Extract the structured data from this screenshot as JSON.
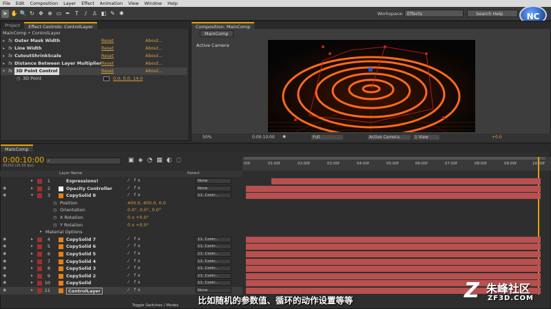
{
  "menu": [
    "File",
    "Edit",
    "Composition",
    "Layer",
    "Effect",
    "Animation",
    "View",
    "Window",
    "Help"
  ],
  "workspace": {
    "label": "Workspace:",
    "value": "Effects",
    "search_placeholder": "Search Help"
  },
  "left_panel": {
    "tabs": [
      "Project",
      "Effect Controls: ControlLayer"
    ],
    "breadcrumb": "MainComp • ControlLayer",
    "effects": [
      {
        "name": "Outer Mask Width",
        "reset": "Reset",
        "about": "About..."
      },
      {
        "name": "Line Width",
        "reset": "Reset",
        "about": "About..."
      },
      {
        "name": "CutoutShrinkScale",
        "reset": "Reset",
        "about": "About..."
      },
      {
        "name": "Distance Between Layer Multiplier",
        "reset": "Reset",
        "about": "About..."
      },
      {
        "name": "3D Point Control",
        "reset": "Reset",
        "about": "About..."
      }
    ],
    "point_prop": {
      "name": "3D Point",
      "value": "0.0, 0.0, 14.0"
    }
  },
  "comp_panel": {
    "tab": "Composition: MainComp",
    "subtab": "MainComp",
    "view_label": "Active Camera",
    "zoom": "50%",
    "timecode": "0:00:10:00",
    "resolution": "Full",
    "camera": "Active Camera",
    "views": "1 View",
    "exposure": "+0.0"
  },
  "timeline": {
    "tab": "MainComp",
    "timecode": "0:00:10:00",
    "fps": "00250 (25.00 fps)",
    "col_layer": "Layer Name",
    "col_parent": "Parent",
    "ruler": [
      "00f",
      "01:00f",
      "02:00f",
      "03:00f",
      "04:00f",
      "05:00f",
      "06:00f",
      "07:00f",
      "08:00f",
      "09:00f",
      "10:00f"
    ],
    "layers_top": [
      {
        "num": "1",
        "name": "Expressions!",
        "parent": "None",
        "swatch": "#a03030"
      },
      {
        "num": "2",
        "name": "Opacity Controller",
        "parent": "None",
        "swatch": "#ffffff"
      },
      {
        "num": "3",
        "name": "CopySolid 8",
        "parent": "11. Contr...",
        "swatch": "#e6801a"
      }
    ],
    "props": [
      {
        "name": "Position",
        "value": "400.0, 400.0, 0.0"
      },
      {
        "name": "Orientation",
        "value": "0.0°, 0.0°, 0.0°"
      },
      {
        "name": "X Rotation",
        "value": "0 x +0.0°"
      },
      {
        "name": "Y Rotation",
        "value": "0 x +0.0°"
      }
    ],
    "material": "Material Options",
    "layers_bottom": [
      {
        "num": "4",
        "name": "CopySolid 7",
        "parent": "11. Contr..."
      },
      {
        "num": "5",
        "name": "CopySolid 6",
        "parent": "11. Contr..."
      },
      {
        "num": "6",
        "name": "CopySolid 5",
        "parent": "11. Contr..."
      },
      {
        "num": "7",
        "name": "CopySolid 4",
        "parent": "11. Contr..."
      },
      {
        "num": "8",
        "name": "CopySolid 3",
        "parent": "11. Contr..."
      },
      {
        "num": "9",
        "name": "CopySolid 2",
        "parent": "11. Contr..."
      },
      {
        "num": "10",
        "name": "CopySolid",
        "parent": "11. Contr..."
      },
      {
        "num": "11",
        "name": "ControlLayer",
        "parent": "None"
      }
    ],
    "toggle_label": "Toggle Switches / Modes"
  },
  "subtitle": "比如随机的参数值、循环的动作设置等等",
  "watermark": {
    "brand": "朱峰社区",
    "site": "ZF3D.COM"
  },
  "colors": {
    "accent": "#f0b000",
    "bar": "#b85050",
    "ring": "#ff6a1a"
  }
}
